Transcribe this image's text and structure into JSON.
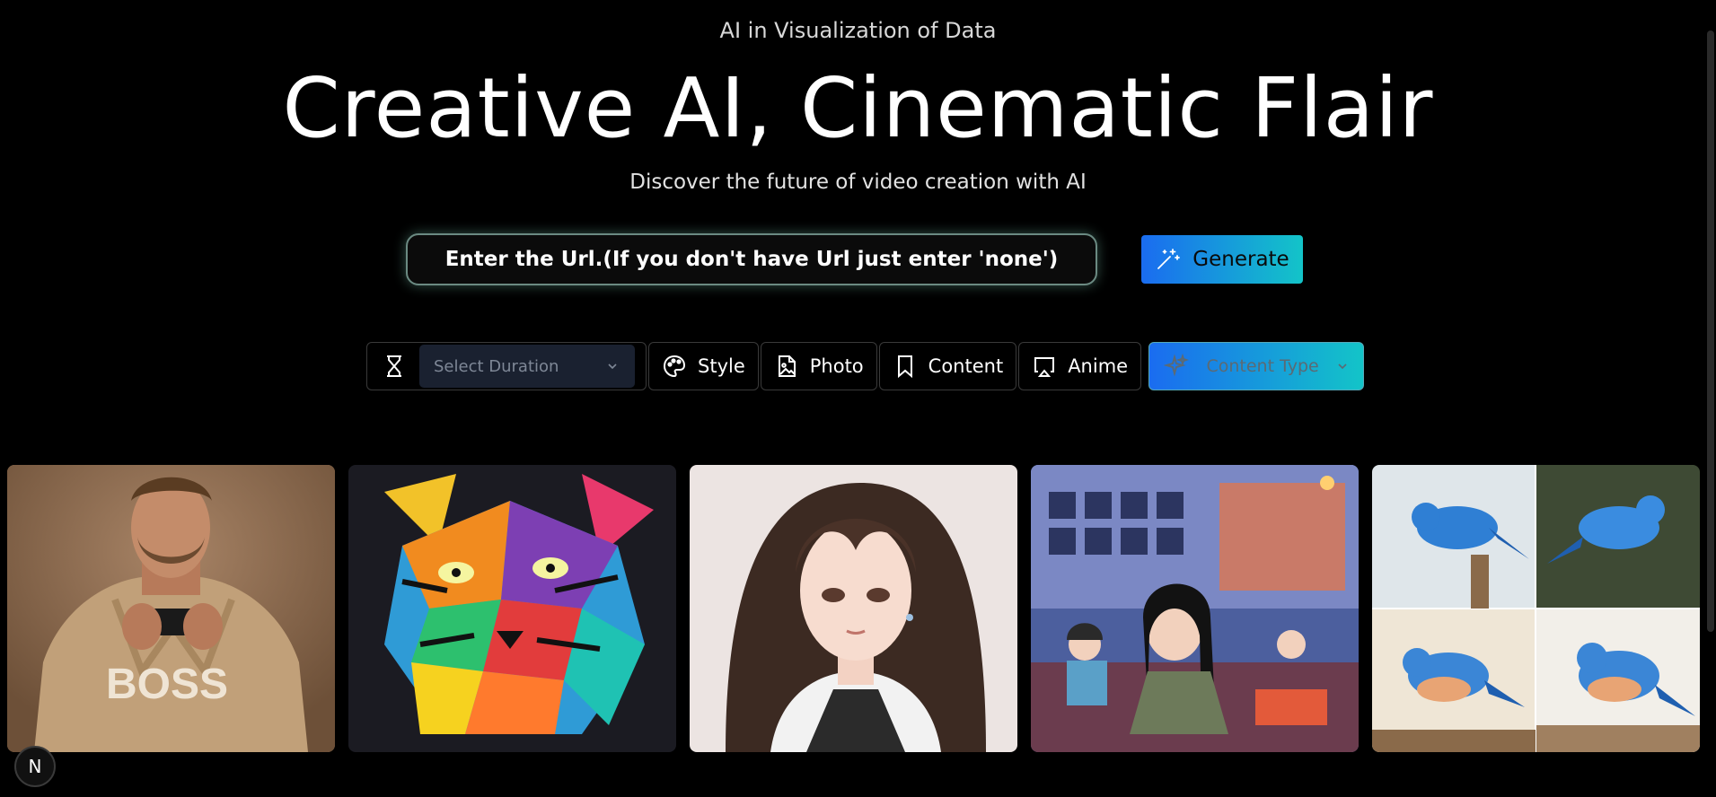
{
  "header": {
    "eyebrow": "AI in Visualization of Data",
    "title": "Creative AI, Cinematic Flair",
    "subtitle": "Discover the future of video creation with AI"
  },
  "search": {
    "placeholder": "Enter the Url.(If you don't have Url just enter 'none')",
    "value": ""
  },
  "generate": {
    "label": "Generate",
    "icon": "magic-wand-icon"
  },
  "toolbar": {
    "duration": {
      "icon": "hourglass-icon",
      "placeholder": "Select Duration"
    },
    "style": {
      "label": "Style",
      "icon": "palette-icon"
    },
    "photo": {
      "label": "Photo",
      "icon": "image-file-icon"
    },
    "content": {
      "label": "Content",
      "icon": "bookmark-icon"
    },
    "anime": {
      "label": "Anime",
      "icon": "airplay-icon"
    },
    "content_type": {
      "placeholder": "Content Type",
      "icon": "sparkles-icon"
    }
  },
  "gallery": [
    {
      "subject": "man-in-hoodie"
    },
    {
      "subject": "colorful-tiger"
    },
    {
      "subject": "anime-girl"
    },
    {
      "subject": "anime-artist-studio"
    },
    {
      "subject": "bluebirds-watercolor"
    }
  ],
  "badge": {
    "label": "N"
  },
  "colors": {
    "accent_start": "#1a6cf0",
    "accent_end": "#13c4c8",
    "background": "#000000"
  }
}
